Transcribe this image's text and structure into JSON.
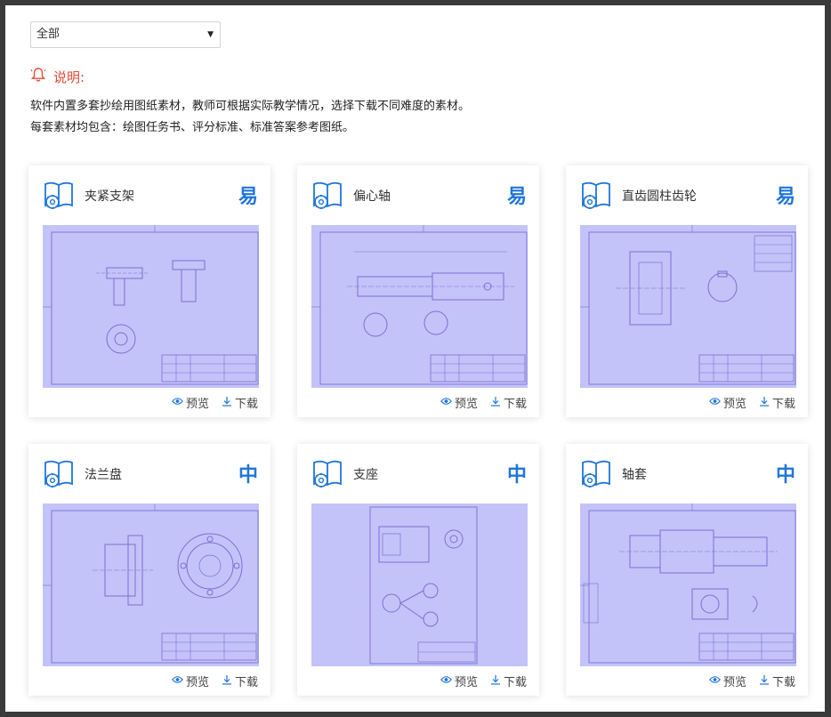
{
  "filter": {
    "selected": "全部",
    "arrow_icon": "triangle-down-icon"
  },
  "notice": {
    "icon": "bell-icon",
    "title": "说明:",
    "lines": [
      "软件内置多套抄绘用图纸素材，教师可根据实际教学情况，选择下载不同难度的素材。",
      "每套素材均包含：绘图任务书、评分标准、标准答案参考图纸。"
    ]
  },
  "colors": {
    "accent": "#1f76d9",
    "notice": "#e34b36",
    "thumb_bg": "#c3c3f9",
    "line": "#7b6fd4"
  },
  "actions": {
    "preview": "预览",
    "download": "下载",
    "preview_icon": "eye-icon",
    "download_icon": "download-icon"
  },
  "cards": [
    {
      "title": "夹紧支架",
      "difficulty": "易",
      "icon": "book-gear-icon"
    },
    {
      "title": "偏心轴",
      "difficulty": "易",
      "icon": "book-gear-icon"
    },
    {
      "title": "直齿圆柱齿轮",
      "difficulty": "易",
      "icon": "book-gear-icon"
    },
    {
      "title": "法兰盘",
      "difficulty": "中",
      "icon": "book-gear-icon"
    },
    {
      "title": "支座",
      "difficulty": "中",
      "icon": "book-gear-icon"
    },
    {
      "title": "轴套",
      "difficulty": "中",
      "icon": "book-gear-icon"
    }
  ]
}
